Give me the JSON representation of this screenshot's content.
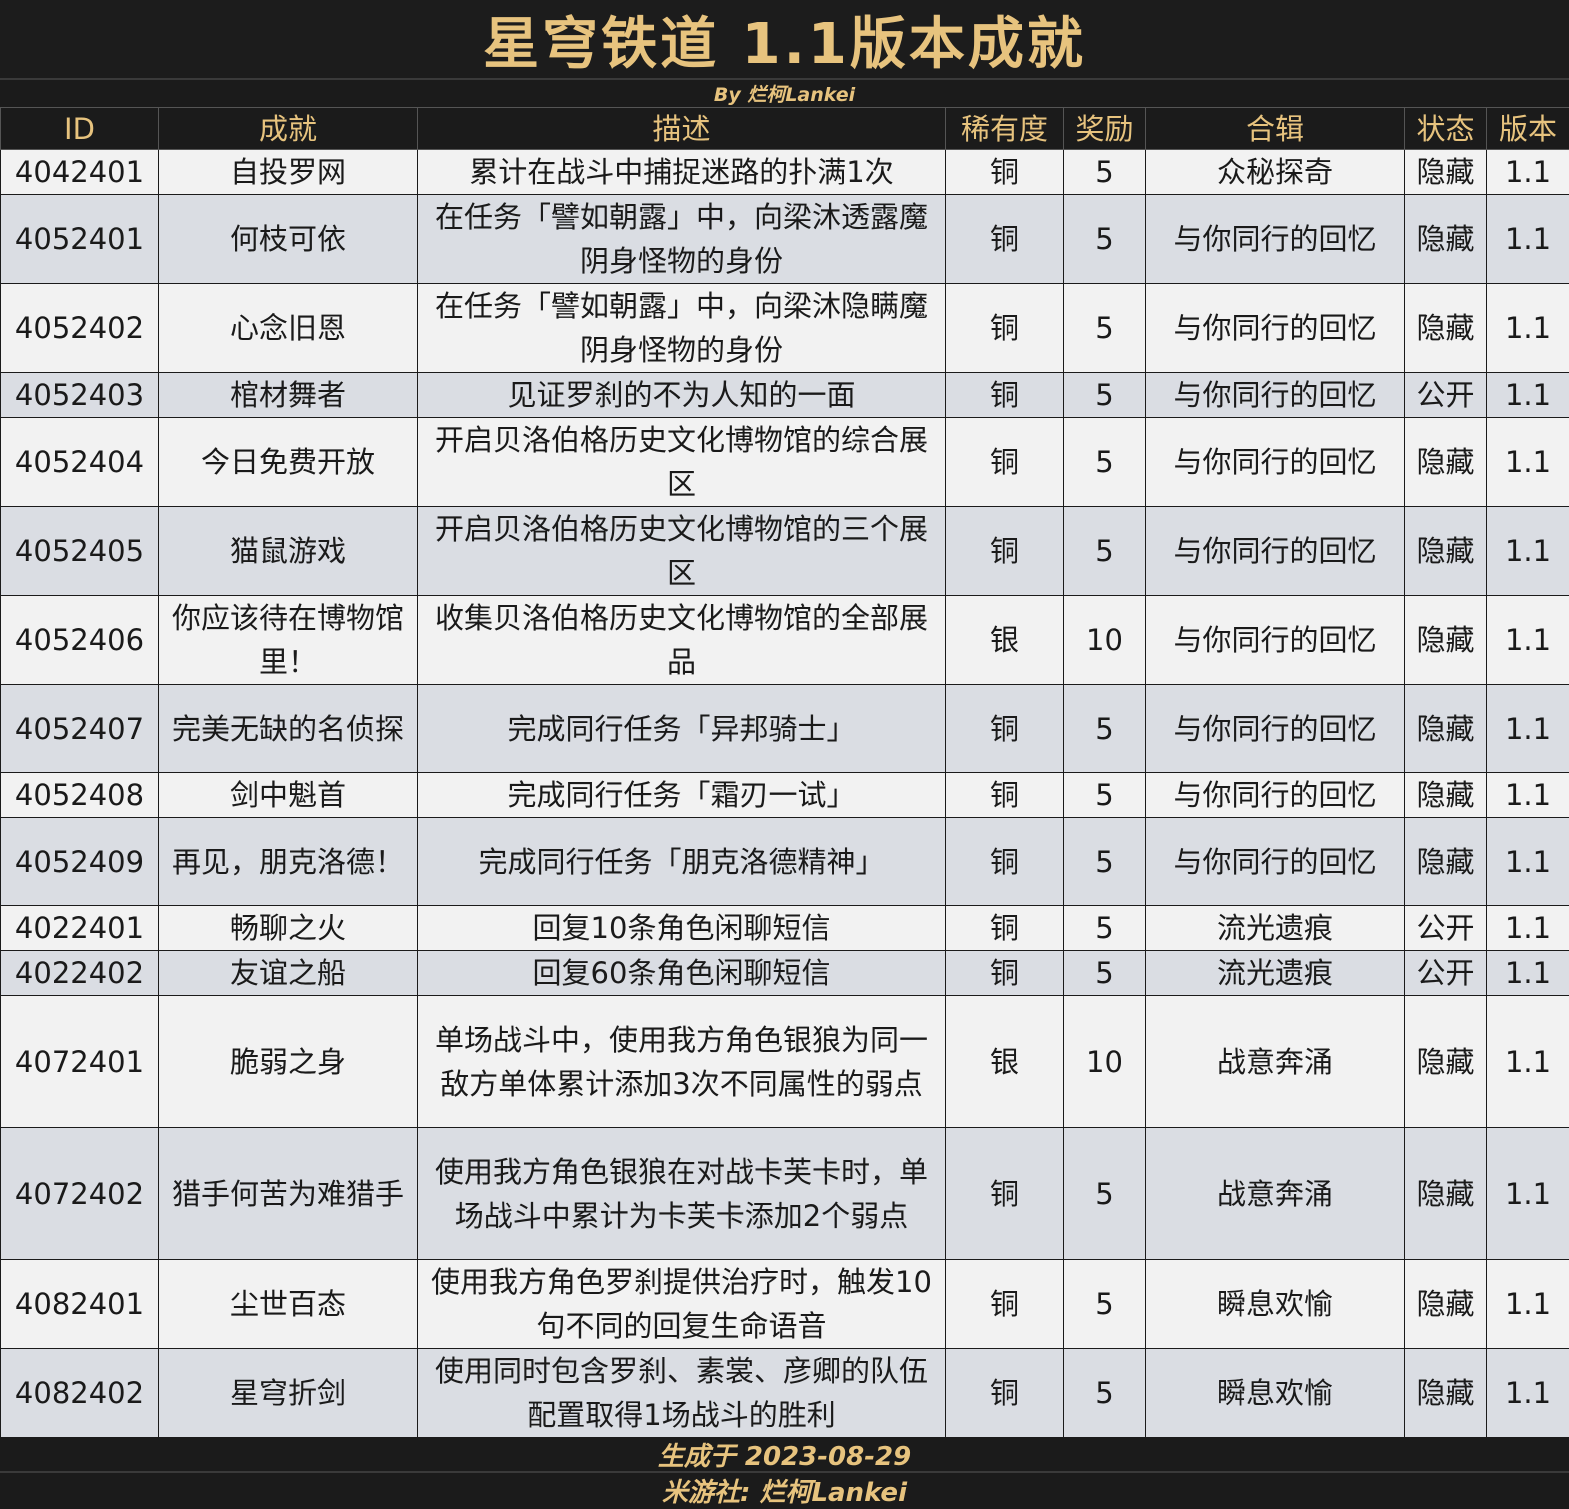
{
  "title": "星穹铁道 1.1版本成就",
  "byline": "By 烂柯Lankei",
  "columns": [
    "ID",
    "成就",
    "描述",
    "稀有度",
    "奖励",
    "合辑",
    "状态",
    "版本"
  ],
  "rows": [
    {
      "id": "4042401",
      "name": "自投罗网",
      "desc": "累计在战斗中捕捉迷路的扑满1次",
      "rarity": "铜",
      "reward": "5",
      "series": "众秘探奇",
      "status": "隐藏",
      "version": "1.1"
    },
    {
      "id": "4052401",
      "name": "何枝可依",
      "desc": "在任务「譬如朝露」中，向梁沐透露魔阴身怪物的身份",
      "rarity": "铜",
      "reward": "5",
      "series": "与你同行的回忆",
      "status": "隐藏",
      "version": "1.1"
    },
    {
      "id": "4052402",
      "name": "心念旧恩",
      "desc": "在任务「譬如朝露」中，向梁沐隐瞒魔阴身怪物的身份",
      "rarity": "铜",
      "reward": "5",
      "series": "与你同行的回忆",
      "status": "隐藏",
      "version": "1.1"
    },
    {
      "id": "4052403",
      "name": "棺材舞者",
      "desc": "见证罗刹的不为人知的一面",
      "rarity": "铜",
      "reward": "5",
      "series": "与你同行的回忆",
      "status": "公开",
      "version": "1.1"
    },
    {
      "id": "4052404",
      "name": "今日免费开放",
      "desc": "开启贝洛伯格历史文化博物馆的综合展区",
      "rarity": "铜",
      "reward": "5",
      "series": "与你同行的回忆",
      "status": "隐藏",
      "version": "1.1"
    },
    {
      "id": "4052405",
      "name": "猫鼠游戏",
      "desc": "开启贝洛伯格历史文化博物馆的三个展区",
      "rarity": "铜",
      "reward": "5",
      "series": "与你同行的回忆",
      "status": "隐藏",
      "version": "1.1"
    },
    {
      "id": "4052406",
      "name": "你应该待在博物馆里！",
      "desc": "收集贝洛伯格历史文化博物馆的全部展品",
      "rarity": "银",
      "reward": "10",
      "series": "与你同行的回忆",
      "status": "隐藏",
      "version": "1.1"
    },
    {
      "id": "4052407",
      "name": "完美无缺的名侦探",
      "desc": "完成同行任务「异邦骑士」",
      "rarity": "铜",
      "reward": "5",
      "series": "与你同行的回忆",
      "status": "隐藏",
      "version": "1.1"
    },
    {
      "id": "4052408",
      "name": "剑中魁首",
      "desc": "完成同行任务「霜刃一试」",
      "rarity": "铜",
      "reward": "5",
      "series": "与你同行的回忆",
      "status": "隐藏",
      "version": "1.1"
    },
    {
      "id": "4052409",
      "name": "再见，朋克洛德！",
      "desc": "完成同行任务「朋克洛德精神」",
      "rarity": "铜",
      "reward": "5",
      "series": "与你同行的回忆",
      "status": "隐藏",
      "version": "1.1"
    },
    {
      "id": "4022401",
      "name": "畅聊之火",
      "desc": "回复10条角色闲聊短信",
      "rarity": "铜",
      "reward": "5",
      "series": "流光遗痕",
      "status": "公开",
      "version": "1.1"
    },
    {
      "id": "4022402",
      "name": "友谊之船",
      "desc": "回复60条角色闲聊短信",
      "rarity": "铜",
      "reward": "5",
      "series": "流光遗痕",
      "status": "公开",
      "version": "1.1"
    },
    {
      "id": "4072401",
      "name": "脆弱之身",
      "desc": "单场战斗中，使用我方角色银狼为同一敌方单体累计添加3次不同属性的弱点",
      "rarity": "银",
      "reward": "10",
      "series": "战意奔涌",
      "status": "隐藏",
      "version": "1.1"
    },
    {
      "id": "4072402",
      "name": "猎手何苦为难猎手",
      "desc": "使用我方角色银狼在对战卡芙卡时，单场战斗中累计为卡芙卡添加2个弱点",
      "rarity": "铜",
      "reward": "5",
      "series": "战意奔涌",
      "status": "隐藏",
      "version": "1.1"
    },
    {
      "id": "4082401",
      "name": "尘世百态",
      "desc": "使用我方角色罗刹提供治疗时，触发10句不同的回复生命语音",
      "rarity": "铜",
      "reward": "5",
      "series": "瞬息欢愉",
      "status": "隐藏",
      "version": "1.1"
    },
    {
      "id": "4082402",
      "name": "星穹折剑",
      "desc": "使用同时包含罗刹、素裳、彦卿的队伍配置取得1场战斗的胜利",
      "rarity": "铜",
      "reward": "5",
      "series": "瞬息欢愉",
      "status": "隐藏",
      "version": "1.1"
    }
  ],
  "footer": {
    "generated": "生成于 2023-08-29",
    "credit": "米游社: 烂柯Lankei"
  }
}
